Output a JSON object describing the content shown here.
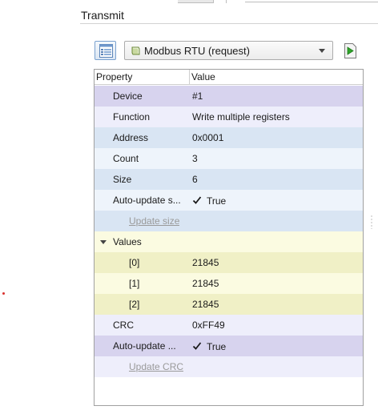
{
  "section": {
    "title": "Transmit"
  },
  "toolbar": {
    "protocol_select": "Modbus RTU (request)"
  },
  "grid": {
    "headers": {
      "property": "Property",
      "value": "Value"
    },
    "rows": [
      {
        "name": "Device",
        "value": "#1"
      },
      {
        "name": "Function",
        "value": "Write multiple registers"
      },
      {
        "name": "Address",
        "value": "0x0001"
      },
      {
        "name": "Count",
        "value": "3"
      },
      {
        "name": "Size",
        "value": "6"
      },
      {
        "name": "Auto-update s...",
        "value": "True",
        "checked": true
      },
      {
        "name": "Update size"
      },
      {
        "name": "Values"
      },
      {
        "name": "[0]",
        "value": "21845"
      },
      {
        "name": "[1]",
        "value": "21845"
      },
      {
        "name": "[2]",
        "value": "21845"
      },
      {
        "name": "CRC",
        "value": "0xFF49"
      },
      {
        "name": "Auto-update ...",
        "value": "True",
        "checked": true
      },
      {
        "name": "Update CRC"
      }
    ]
  },
  "colors": {
    "header_rows": "#d7d3ee",
    "light_purple": "#eeeefb",
    "blue_row": "#d9e5f3",
    "light_blue_row": "#eef4fb",
    "values_group": "#fbfbe1",
    "values_item": "#f0f0c6"
  },
  "icons": {
    "list_view": "list-view-icon",
    "protocol": "packet-icon",
    "send": "send-play-icon",
    "checkbox": "checkmark-icon",
    "expander": "triangle-down-icon"
  }
}
